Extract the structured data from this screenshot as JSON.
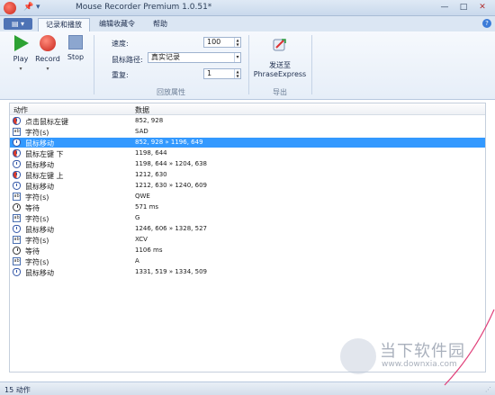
{
  "window": {
    "title": "Mouse Recorder Premium 1.0.51*"
  },
  "tabs": [
    {
      "label": "记录和播放"
    },
    {
      "label": "编辑收藏令"
    },
    {
      "label": "帮助"
    }
  ],
  "ribbon": {
    "play": "Play",
    "record": "Record",
    "stop": "Stop",
    "speed_label": "速度:",
    "speed_value": "100",
    "path_label": "鼠标路径:",
    "path_value": "真实记录",
    "repeat_label": "重复:",
    "repeat_value": "1",
    "group_playback": "回放属性",
    "send_label_1": "发送至",
    "send_label_2": "PhraseExpress",
    "group_export": "导出"
  },
  "list": {
    "col_action": "动作",
    "col_data": "数据",
    "rows": [
      {
        "action": "点击鼠标左键",
        "data": "852, 928",
        "icon": "mouse-left-click-icon"
      },
      {
        "action": "字符(s)",
        "data": "SAD",
        "icon": "text-icon"
      },
      {
        "action": "鼠标移动",
        "data": "852, 928 » 1196, 649",
        "icon": "mouse-move-icon"
      },
      {
        "action": "鼠标左键 下",
        "data": "1198, 644",
        "icon": "mouse-left-down-icon"
      },
      {
        "action": "鼠标移动",
        "data": "1198, 644 » 1204, 638",
        "icon": "mouse-move-icon"
      },
      {
        "action": "鼠标左键 上",
        "data": "1212, 630",
        "icon": "mouse-left-up-icon"
      },
      {
        "action": "鼠标移动",
        "data": "1212, 630 » 1240, 609",
        "icon": "mouse-move-icon"
      },
      {
        "action": "字符(s)",
        "data": "QWE",
        "icon": "text-icon"
      },
      {
        "action": "等待",
        "data": "571 ms",
        "icon": "wait-clock-icon"
      },
      {
        "action": "字符(s)",
        "data": "G",
        "icon": "text-icon"
      },
      {
        "action": "鼠标移动",
        "data": "1246, 606 » 1328, 527",
        "icon": "mouse-move-icon"
      },
      {
        "action": "字符(s)",
        "data": "XCV",
        "icon": "text-icon"
      },
      {
        "action": "等待",
        "data": "1106 ms",
        "icon": "wait-clock-icon"
      },
      {
        "action": "字符(s)",
        "data": "A",
        "icon": "text-icon"
      },
      {
        "action": "鼠标移动",
        "data": "1331, 519 » 1334, 509",
        "icon": "mouse-move-icon"
      }
    ]
  },
  "status": {
    "text": "15 动作"
  },
  "watermark": {
    "name": "当下软件园",
    "url": "www.downxia.com"
  }
}
